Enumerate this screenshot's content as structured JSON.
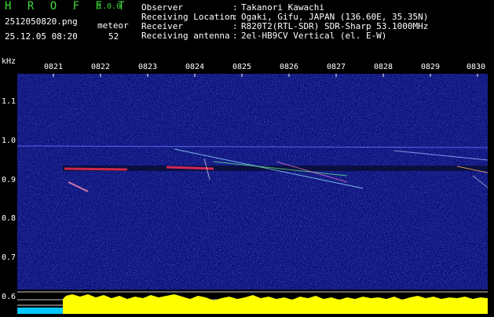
{
  "header": {
    "title": "H R O F F T",
    "version": "1.0.0",
    "file_name": "2512050820.png",
    "datetime": "25.12.05 08:20",
    "meteor_label": "meteor",
    "meteor_count": "52",
    "info": [
      {
        "label": "Observer",
        "value": "Takanori Kawachi"
      },
      {
        "label": "Receiving Location",
        "value": "Ogaki, Gifu, JAPAN (136.60E, 35.35N)"
      },
      {
        "label": "Receiver",
        "value": "R820T2(RTL-SDR) SDR-Sharp 53.1000MHz"
      },
      {
        "label": "Receiving antenna",
        "value": "2el-HB9CV Vertical (el. E-W)"
      }
    ],
    "separator": ":"
  },
  "axes": {
    "unit": "kHz",
    "y_ticks": [
      "1.1",
      "1.0",
      "0.9",
      "0.8",
      "0.7",
      "0.6"
    ],
    "x_ticks": [
      "0821",
      "0822",
      "0823",
      "0824",
      "0825",
      "0826",
      "0827",
      "0828",
      "0829",
      "0830"
    ]
  },
  "colors": {
    "title": "#3fdc3f",
    "background": "#0c0f7a",
    "signal_strip": "#ffff00",
    "signal_strip_start": "#00c8ff"
  }
}
